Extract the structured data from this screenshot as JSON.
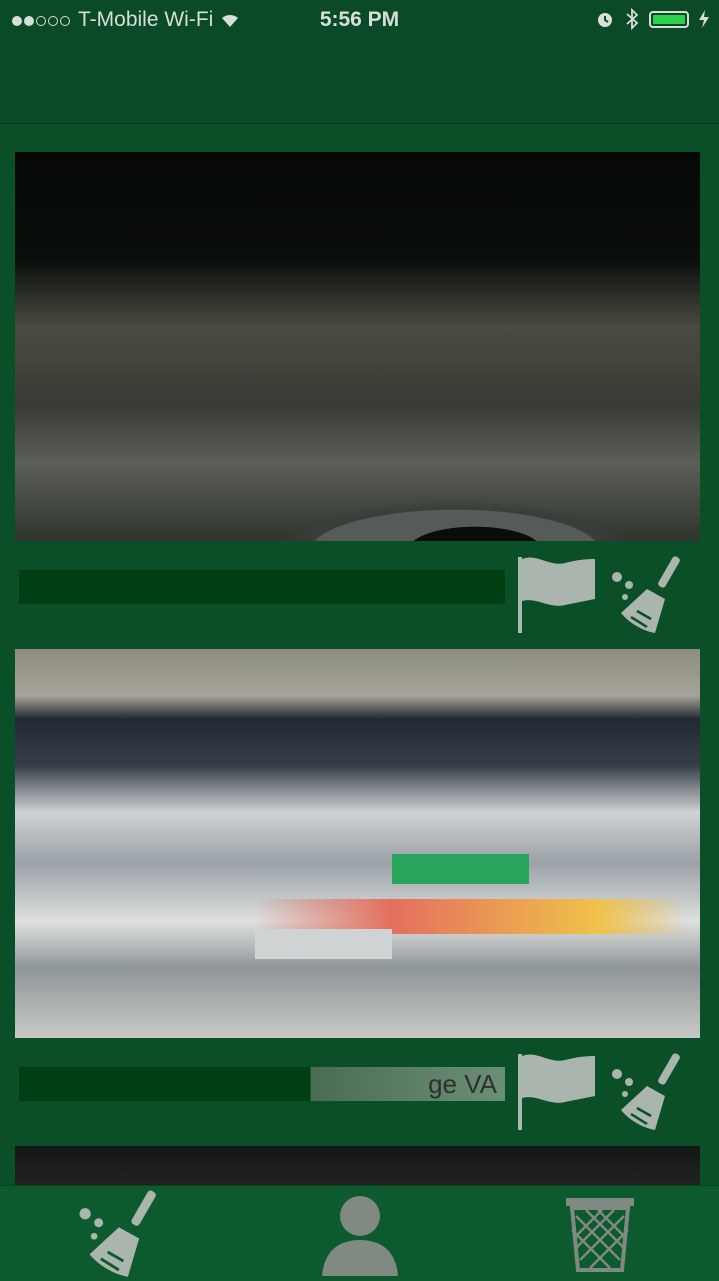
{
  "status_bar": {
    "carrier": "T-Mobile Wi-Fi",
    "time": "5:56 PM",
    "signal_dots_filled": 2,
    "signal_dots_total": 5,
    "battery_level": 1.0,
    "icons": [
      "wifi-icon",
      "alarm-icon",
      "bluetooth-icon",
      "battery-icon",
      "charging-icon"
    ]
  },
  "feed": {
    "posts": [
      {
        "photo": "tire in litter",
        "caption": "",
        "actions": [
          "flag-icon",
          "broom-icon"
        ]
      },
      {
        "photo": "plastic bottles on shore",
        "caption": "ge VA",
        "actions": [
          "flag-icon",
          "broom-icon"
        ]
      }
    ]
  },
  "tab_bar": {
    "tabs": [
      {
        "icon": "broom-icon"
      },
      {
        "icon": "person-icon"
      },
      {
        "icon": "trash-icon"
      }
    ]
  },
  "colors": {
    "background": "#0b4f28",
    "bar": "#0a4a26",
    "icon": "#a9b5ad",
    "caption_bg": "#003f13"
  }
}
